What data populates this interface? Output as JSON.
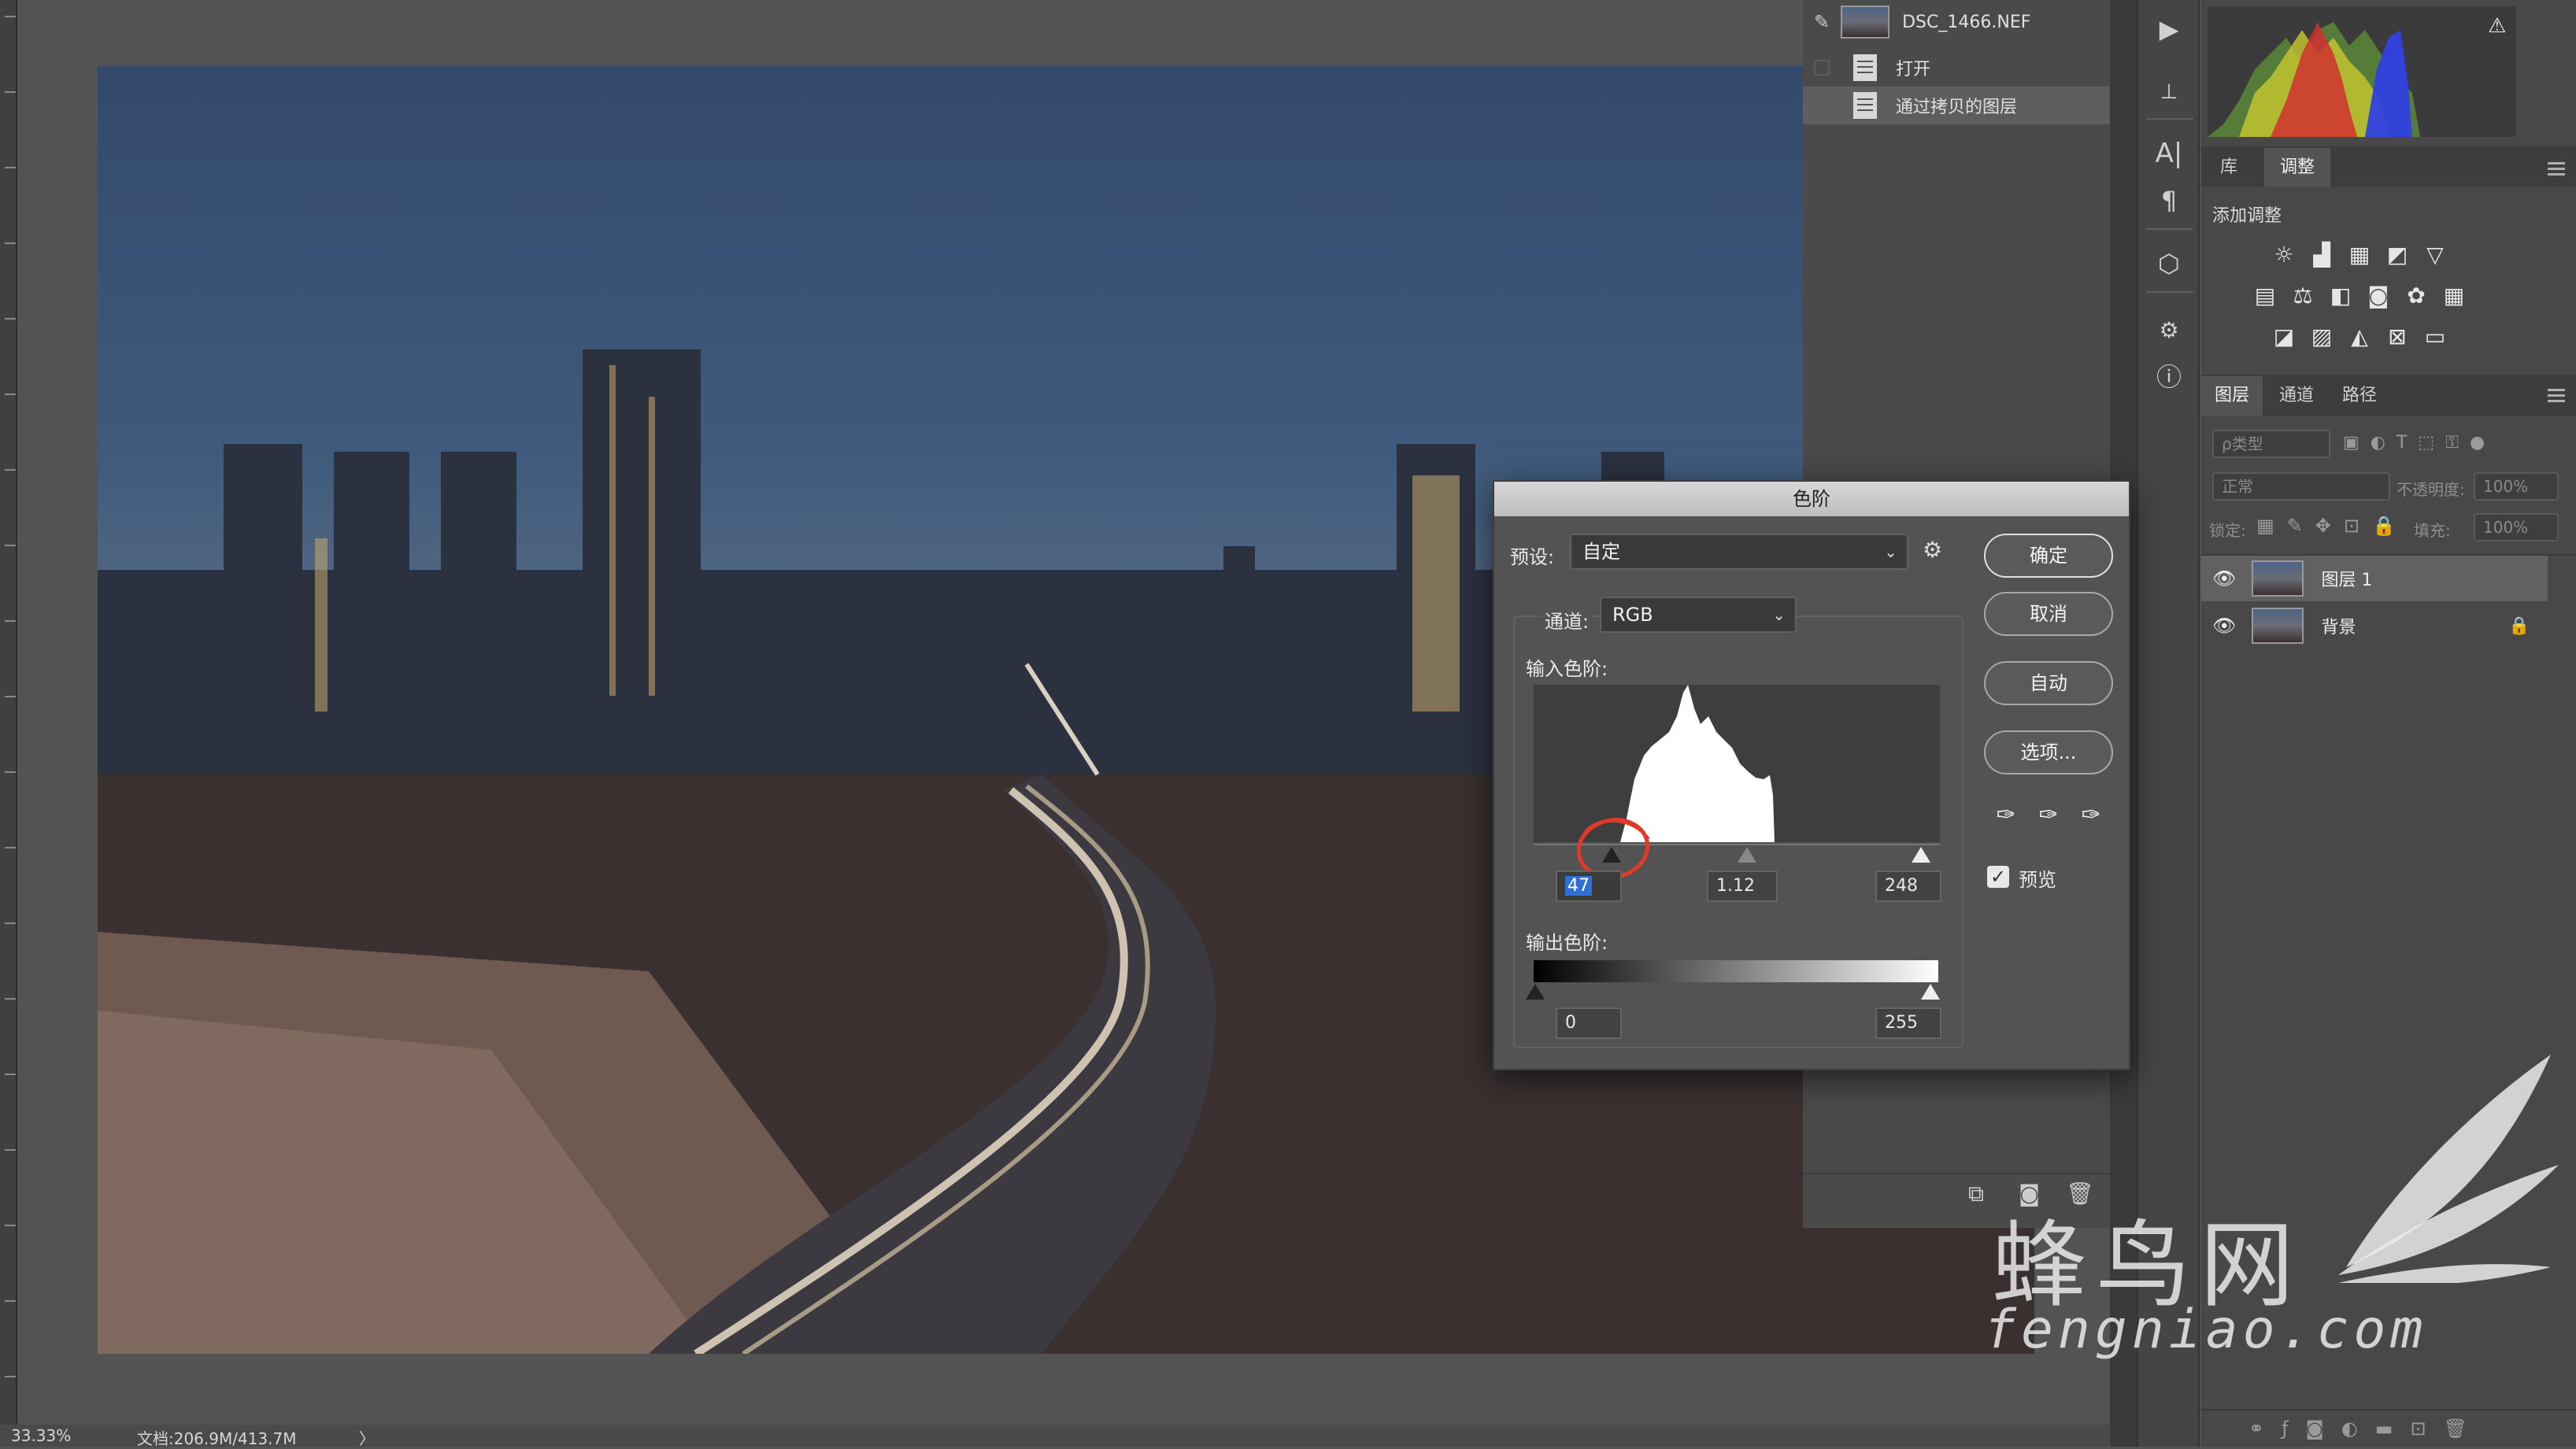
{
  "status": {
    "zoom": "33.33%",
    "doc_info": "文档:206.9M/413.7M",
    "arrow": "〉"
  },
  "history": {
    "snapshot_name": "DSC_1466.NEF",
    "items": [
      {
        "label": "打开"
      },
      {
        "label": "通过拷贝的图层"
      }
    ]
  },
  "adjust_panel": {
    "tabs": [
      "库",
      "调整"
    ],
    "add_label": "添加调整"
  },
  "layers_panel": {
    "tabs": [
      "图层",
      "通道",
      "路径"
    ],
    "filter_placeholder": "ρ类型",
    "blend_mode": "正常",
    "opacity_label": "不透明度:",
    "opacity_value": "100%",
    "lock_label": "锁定:",
    "fill_label": "填充:",
    "fill_value": "100%",
    "layers": [
      {
        "name": "图层 1"
      },
      {
        "name": "背景"
      }
    ]
  },
  "levels_dialog": {
    "title": "色阶",
    "preset_label": "预设:",
    "preset_value": "自定",
    "channel_label": "通道:",
    "channel_value": "RGB",
    "input_label": "输入色阶:",
    "input_black": "47",
    "input_gamma": "1.12",
    "input_white": "248",
    "input_black_frac": 0.184,
    "input_gamma_frac": 0.547,
    "output_label": "输出色阶:",
    "output_black": "0",
    "output_white": "255",
    "buttons": {
      "ok": "确定",
      "cancel": "取消",
      "auto": "自动",
      "options": "选项..."
    },
    "preview_label": "预览",
    "preview_checked": true
  },
  "watermark": {
    "cn": "蜂鸟网",
    "en": "fengniao.com"
  }
}
